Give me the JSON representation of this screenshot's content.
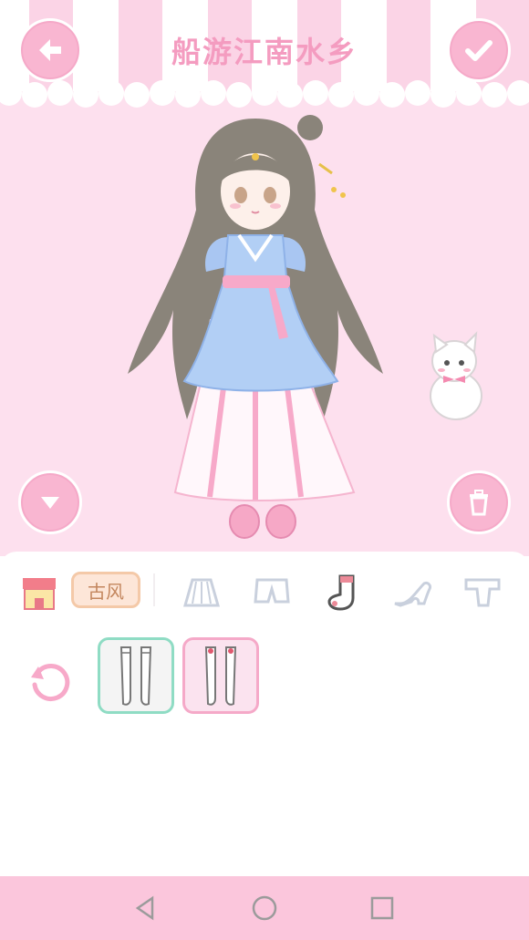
{
  "header": {
    "title": "船游江南水乡",
    "back_icon": "arrow-left-icon",
    "confirm_icon": "checkmark-icon"
  },
  "stage": {
    "collapse_icon": "chevron-down-icon",
    "delete_icon": "trash-icon"
  },
  "categories": {
    "shop_icon": "shop-icon",
    "style_filter_label": "古风",
    "tabs": [
      {
        "icon": "skirt-icon"
      },
      {
        "icon": "shorts-icon"
      },
      {
        "icon": "sock-icon",
        "selected": true
      },
      {
        "icon": "high-heel-icon"
      },
      {
        "icon": "shirt-icon"
      }
    ]
  },
  "items": {
    "reset_icon": "undo-icon",
    "options": [
      {
        "name": "white-stockings",
        "selected": true
      },
      {
        "name": "white-stockings-red-bow",
        "selected": false
      }
    ]
  },
  "navbar": {
    "back_icon": "triangle-back-icon",
    "home_icon": "circle-home-icon",
    "recents_icon": "square-recents-icon"
  },
  "colors": {
    "stage_bg": "#fde0ee",
    "accent_pink": "#f9b6d1",
    "title_pink": "#f49cc0",
    "selected_border": "#8fdcc4",
    "navbar": "#fbc6dc"
  }
}
